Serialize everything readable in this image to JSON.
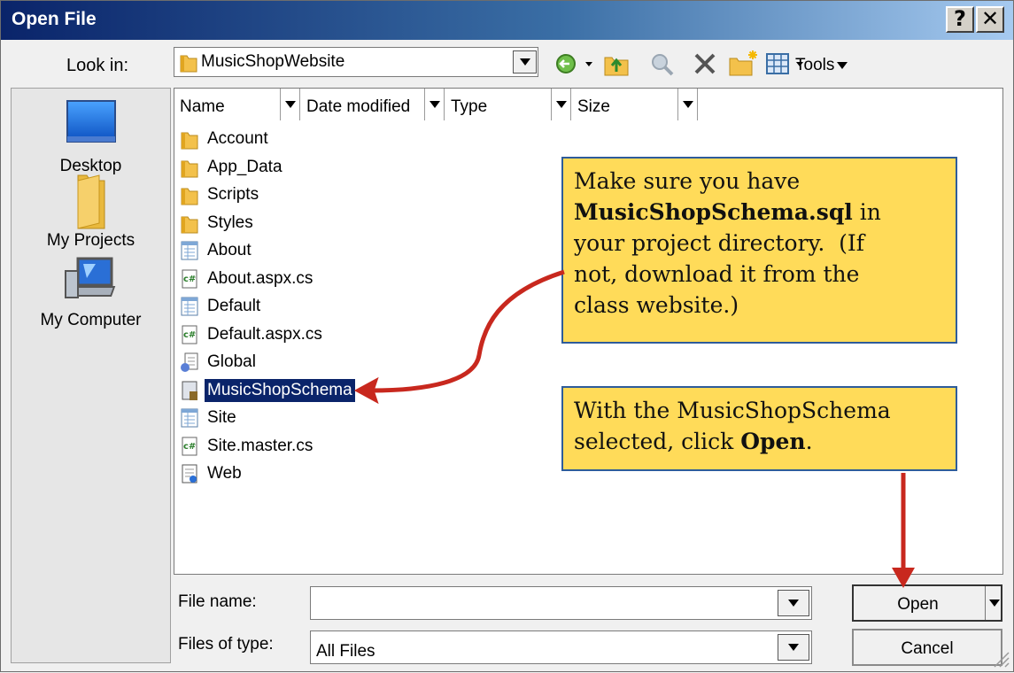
{
  "window": {
    "title": "Open File",
    "help_label": "?",
    "close_label": "✕"
  },
  "look_in": {
    "label": "Look in:",
    "value": "MusicShopWebsite"
  },
  "toolbar": {
    "icons": [
      "back-icon",
      "up-folder-icon",
      "search-web-icon",
      "delete-icon",
      "new-folder-icon",
      "views-icon"
    ],
    "tools_label": "Tools"
  },
  "places": [
    {
      "label": "Desktop",
      "icon": "desktop-icon"
    },
    {
      "label": "My Projects",
      "icon": "folder-icon"
    },
    {
      "label": "My Computer",
      "icon": "computer-icon"
    }
  ],
  "columns": [
    "Name",
    "Date modified",
    "Type",
    "Size"
  ],
  "files": [
    {
      "name": "Account",
      "icon": "folder-icon"
    },
    {
      "name": "App_Data",
      "icon": "folder-icon"
    },
    {
      "name": "Scripts",
      "icon": "folder-icon"
    },
    {
      "name": "Styles",
      "icon": "folder-icon"
    },
    {
      "name": "About",
      "icon": "aspx-page-icon"
    },
    {
      "name": "About.aspx.cs",
      "icon": "csharp-file-icon"
    },
    {
      "name": "Default",
      "icon": "aspx-page-icon"
    },
    {
      "name": "Default.aspx.cs",
      "icon": "csharp-file-icon"
    },
    {
      "name": "Global",
      "icon": "global-asax-icon"
    },
    {
      "name": "MusicShopSchema",
      "icon": "sql-file-icon",
      "selected": true
    },
    {
      "name": "Site",
      "icon": "aspx-page-icon"
    },
    {
      "name": "Site.master.cs",
      "icon": "csharp-file-icon"
    },
    {
      "name": "Web",
      "icon": "web-config-icon"
    }
  ],
  "file_name": {
    "label": "File name:",
    "value": ""
  },
  "file_type": {
    "label": "Files of type:",
    "value": "All Files"
  },
  "buttons": {
    "open": "Open",
    "cancel": "Cancel"
  },
  "callouts": {
    "first": {
      "line1": "Make sure you have",
      "bold": "MusicShopSchema.sql",
      "after_bold": " in",
      "line3": "your project directory.  (If",
      "line4": "not, download it from the",
      "line5": "class website.)"
    },
    "second": {
      "line1": "With the MusicShopSchema",
      "line2_pre": "selected, click ",
      "line2_bold": "Open",
      "line2_post": "."
    }
  },
  "colors": {
    "callout_fill": "#ffdb59",
    "callout_border": "#2e5c9a",
    "arrow": "#c8281e",
    "selection": "#0a246a"
  }
}
